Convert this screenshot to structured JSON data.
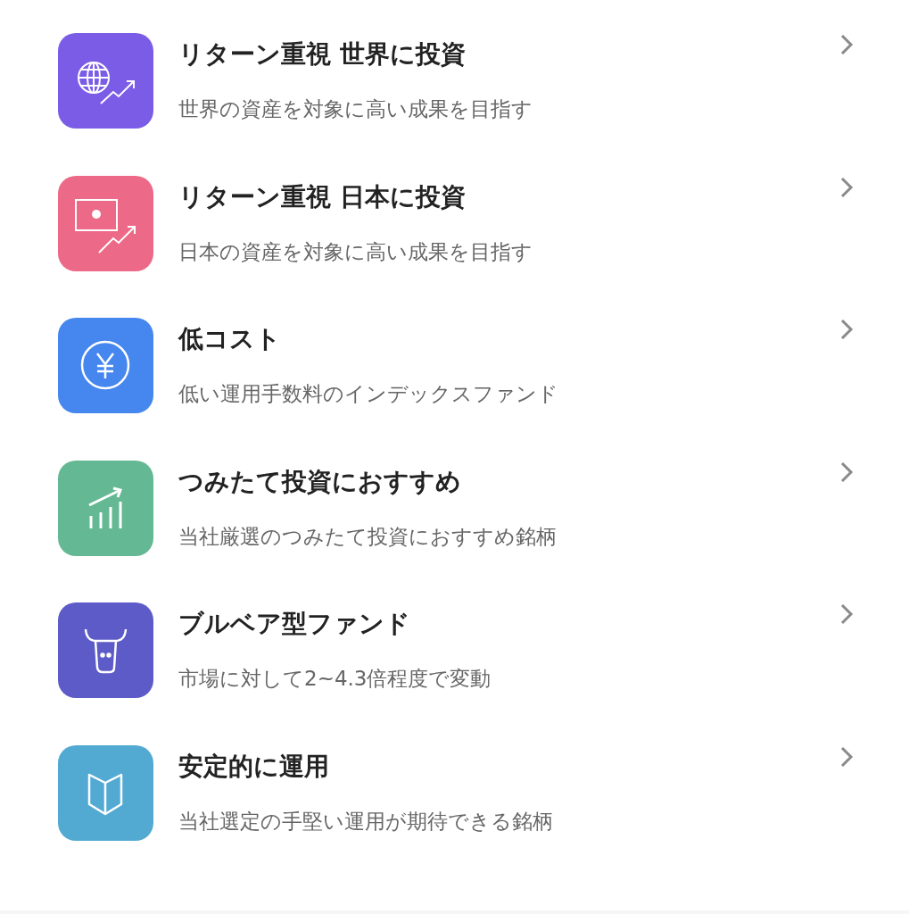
{
  "items": [
    {
      "kind": "globe",
      "color": "#7b5ce6",
      "title": "リターン重視 世界に投資",
      "subtitle": "世界の資産を対象に高い成果を目指す"
    },
    {
      "kind": "flag",
      "color": "#ec6a87",
      "title": "リターン重視 日本に投資",
      "subtitle": "日本の資産を対象に高い成果を目指す"
    },
    {
      "kind": "yen",
      "color": "#4586ef",
      "title": "低コスト",
      "subtitle": "低い運用手数料のインデックスファンド"
    },
    {
      "kind": "bars",
      "color": "#64b894",
      "title": "つみたて投資におすすめ",
      "subtitle": "当社厳選のつみたて投資におすすめ銘柄"
    },
    {
      "kind": "bull",
      "color": "#5c5bc8",
      "title": "ブルベア型ファンド",
      "subtitle": "市場に対して2~4.3倍程度で変動"
    },
    {
      "kind": "book",
      "color": "#52aad3",
      "title": "安定的に運用",
      "subtitle": "当社選定の手堅い運用が期待できる銘柄"
    }
  ]
}
